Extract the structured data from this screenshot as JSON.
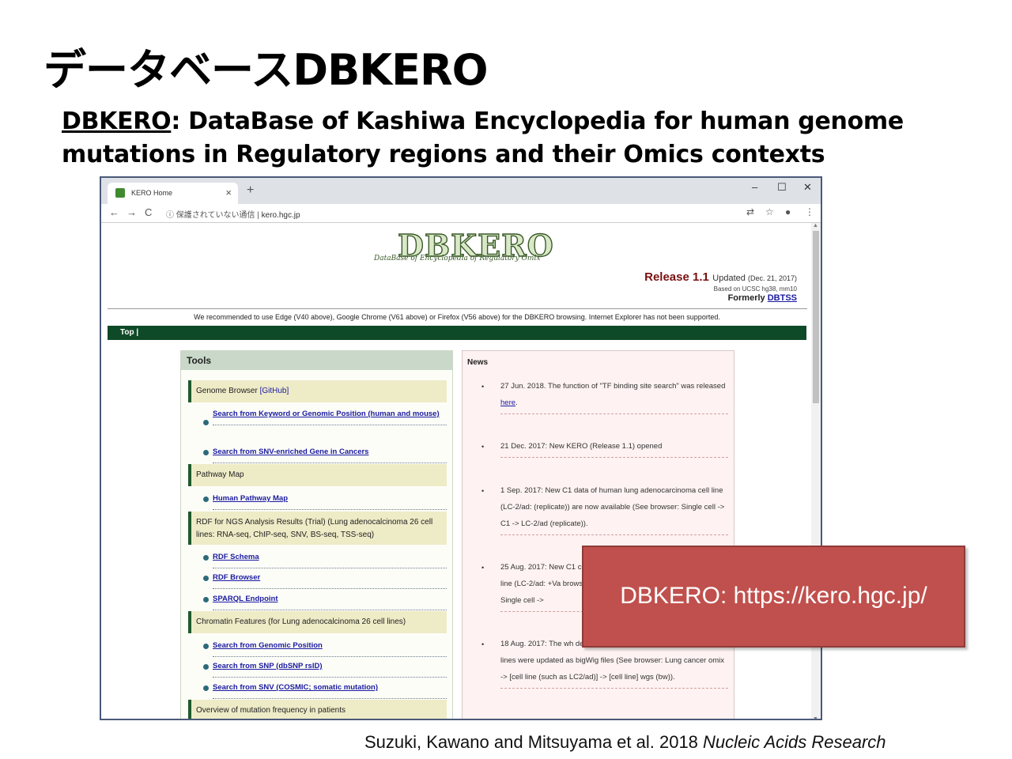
{
  "slide": {
    "title": "データベースDBKERO",
    "subtitle_underlined": "DBKERO",
    "subtitle_rest": ": DataBase of Kashiwa Encyclopedia for human genome mutations in Regulatory regions and their Omics contexts"
  },
  "browser": {
    "tab_title": "KERO Home",
    "tab_close": "×",
    "new_tab": "+",
    "window_controls": [
      "–",
      "☐",
      "✕"
    ],
    "nav": [
      "←",
      "→",
      "C"
    ],
    "url_security": "保護されていない通信",
    "url_host": "kero.hgc.jp"
  },
  "site": {
    "logo": "DBKERO",
    "logo_sub": "DataBase of Encyclopedia of Regulatory Omix",
    "release_big": "Release 1.1",
    "release_updated": "Updated",
    "release_date": "(Dec. 21, 2017)",
    "based_on": "Based on UCSC hg38, mm10",
    "formerly": "Formerly",
    "formerly_link": "DBTSS",
    "recommend": "We recommended to use Edge (V40 above), Google Chrome (V61 above) or Firefox (V56 above) for the DBKERO browsing. Internet Explorer has not been supported.",
    "nav_top": "Top  |"
  },
  "tools": {
    "heading": "Tools",
    "sections": [
      {
        "label": "Genome Browser",
        "link": "[GitHub]"
      },
      {
        "label": "Pathway Map"
      },
      {
        "label": "RDF for NGS Analysis Results (Trial) (Lung adenocalcinoma 26 cell lines: RNA-seq, ChIP-seq, SNV, BS-seq, TSS-seq)"
      },
      {
        "label": "Chromatin Features (for Lung adenocalcinoma 26 cell lines)"
      },
      {
        "label": "Overview of mutation frequency in patients"
      }
    ],
    "links": [
      "Search from Keyword or Genomic Position (human and mouse)",
      "Search from SNV-enriched Gene in Cancers",
      "Human Pathway Map",
      "RDF Schema",
      "RDF Browser",
      "SPARQL Endpoint",
      "Search from Genomic Position",
      "Search from SNP (dbSNP rsID)",
      "Search from SNV (COSMIC; somatic mutation)"
    ]
  },
  "news": {
    "heading": "News",
    "items": [
      {
        "text": "27 Jun. 2018. The function of \"TF binding site search\" was released",
        "link": "here",
        "after": "."
      },
      {
        "text": "21 Dec. 2017: New KERO (Release 1.1) opened"
      },
      {
        "text": "1 Sep. 2017: New C1 data of human lung adenocarcinoma cell line (LC-2/ad: (replicate)) are now available (See browser: Single cell -> C1 -> LC-2/ad (replicate))."
      },
      {
        "text": "25 Aug. 2017: New C1 cell line (LC-2/ad: +Va browser: Single cell ->"
      },
      {
        "text": "18 Aug. 2017: The wh depth data of Lung adenocarcinoma 26 cell lines were updated as bigWig files (See browser: Lung cancer omix -> [cell line (such as LC2/ad)] -> [cell line] wgs (bw))."
      }
    ],
    "bullet": "•"
  },
  "overlay": {
    "text": "DBKERO: https://kero.hgc.jp/"
  },
  "citation": {
    "authors": "Suzuki, Kawano and Mitsuyama et al. 2018 ",
    "journal": "Nucleic Acids Research"
  },
  "colors": {
    "overlay": "#c0504d",
    "greenbar": "#0f4a28",
    "tools_header": "#c9d8c8",
    "section_bg": "#eeebc7",
    "news_bg": "#fef2f2",
    "link": "#1a1aa0",
    "release": "#7a1010"
  }
}
